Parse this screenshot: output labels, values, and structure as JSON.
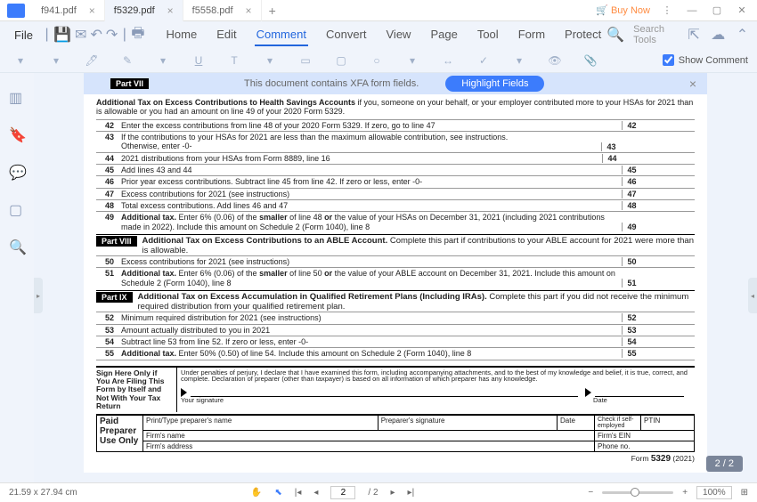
{
  "tabs": [
    {
      "name": "f941.pdf"
    },
    {
      "name": "f5329.pdf"
    },
    {
      "name": "f5558.pdf"
    }
  ],
  "buy_now": "Buy Now",
  "menu": {
    "file": "File",
    "items": [
      "Home",
      "Edit",
      "Comment",
      "Convert",
      "View",
      "Page",
      "Tool",
      "Form",
      "Protect"
    ],
    "search": "Search Tools"
  },
  "show_comment": "Show Comment",
  "xfa": {
    "msg": "This document contains XFA form fields.",
    "btn": "Highlight Fields"
  },
  "doc": {
    "part7": {
      "label": "Part VII",
      "title": "Additional Tax on Excess Contributions to Health Savings Accounts",
      "tail": " if you, someone on your behalf, or your employer contributed more to your HSAs for 2021 than is allowable or you had an amount on line 49 of your 2020 Form 5329."
    },
    "l42": {
      "no": "42",
      "text": "Enter the excess contributions from line 48 of your 2020 Form 5329. If zero, go to line 47",
      "box": "42"
    },
    "l43": {
      "no": "43",
      "text": "If the contributions to your HSAs for 2021 are less than the maximum  allowable contribution, see instructions. Otherwise, enter -0-",
      "box": "43"
    },
    "l44": {
      "no": "44",
      "text": "2021 distributions from your HSAs from Form 8889, line 16",
      "box": "44"
    },
    "l45": {
      "no": "45",
      "text": "Add lines 43 and 44",
      "box": "45"
    },
    "l46": {
      "no": "46",
      "text": "Prior year excess contributions. Subtract line 45 from line 42. If zero or less, enter -0-",
      "box": "46"
    },
    "l47": {
      "no": "47",
      "text": "Excess contributions for 2021 (see instructions)",
      "box": "47"
    },
    "l48": {
      "no": "48",
      "text": "Total excess contributions. Add lines 46 and 47",
      "box": "48"
    },
    "l49": {
      "no": "49",
      "text_a": "Additional tax.",
      "text_b": " Enter 6% (0.06) of the ",
      "text_c": "smaller",
      "text_d": " of line 48 ",
      "text_e": "or",
      "text_f": " the value of your HSAs on December 31, 2021 (including 2021 contributions made in 2022). Include this amount on Schedule 2 (Form 1040), line 8",
      "box": "49"
    },
    "part8": {
      "label": "Part VIII",
      "title": "Additional Tax on Excess Contributions to an ABLE Account.",
      "tail": " Complete this part if contributions to your ABLE account for 2021 were more than is allowable."
    },
    "l50": {
      "no": "50",
      "text": "Excess contributions for 2021 (see instructions)",
      "box": "50"
    },
    "l51": {
      "no": "51",
      "text_a": "Additional tax.",
      "text_b": " Enter 6% (0.06) of the ",
      "text_c": "smaller",
      "text_d": " of line 50 ",
      "text_e": "or",
      "text_f": " the value of your ABLE account on December 31, 2021. Include this amount on Schedule 2 (Form 1040), line 8",
      "box": "51"
    },
    "part9": {
      "label": "Part IX",
      "title": "Additional Tax on Excess Accumulation in Qualified Retirement Plans (Including IRAs).",
      "tail": " Complete this part if you did not receive the minimum required distribution from your qualified retirement plan."
    },
    "l52": {
      "no": "52",
      "text": "Minimum required distribution for 2021 (see instructions)",
      "box": "52"
    },
    "l53": {
      "no": "53",
      "text": "Amount actually distributed to you in 2021",
      "box": "53"
    },
    "l54": {
      "no": "54",
      "text": "Subtract line 53 from line 52. If zero or less, enter -0-",
      "box": "54"
    },
    "l55": {
      "no": "55",
      "text_a": "Additional tax.",
      "text_b": " Enter 50% (0.50) of line 54. Include this amount on Schedule 2 (Form 1040), line 8",
      "box": "55"
    },
    "sign": {
      "left": "Sign Here Only if You Are Filing This Form by Itself and Not With Your Tax Return",
      "perjury": "Under penalties of perjury, I declare that I have examined this form, including accompanying attachments, and to the best of my knowledge and belief, it is true, correct, and complete. Declaration of preparer (other than taxpayer) is based on all information of which preparer has any knowledge.",
      "your_sig": "Your signature",
      "date": "Date"
    },
    "prep": {
      "left": "Paid Preparer Use Only",
      "name": "Print/Type preparer's name",
      "sig": "Preparer's signature",
      "date": "Date",
      "check": "Check       if self-employed",
      "ptin": "PTIN",
      "firm_name": "Firm's name",
      "firm_ein": "Firm's EIN",
      "firm_addr": "Firm's address",
      "phone": "Phone no."
    },
    "footer_a": "Form ",
    "footer_b": "5329",
    "footer_c": " (2021)"
  },
  "page_badge": "2 / 2",
  "status": {
    "dims": "21.59 x 27.94 cm",
    "page": "2",
    "pages": "/ 2",
    "zoom": "100%"
  }
}
